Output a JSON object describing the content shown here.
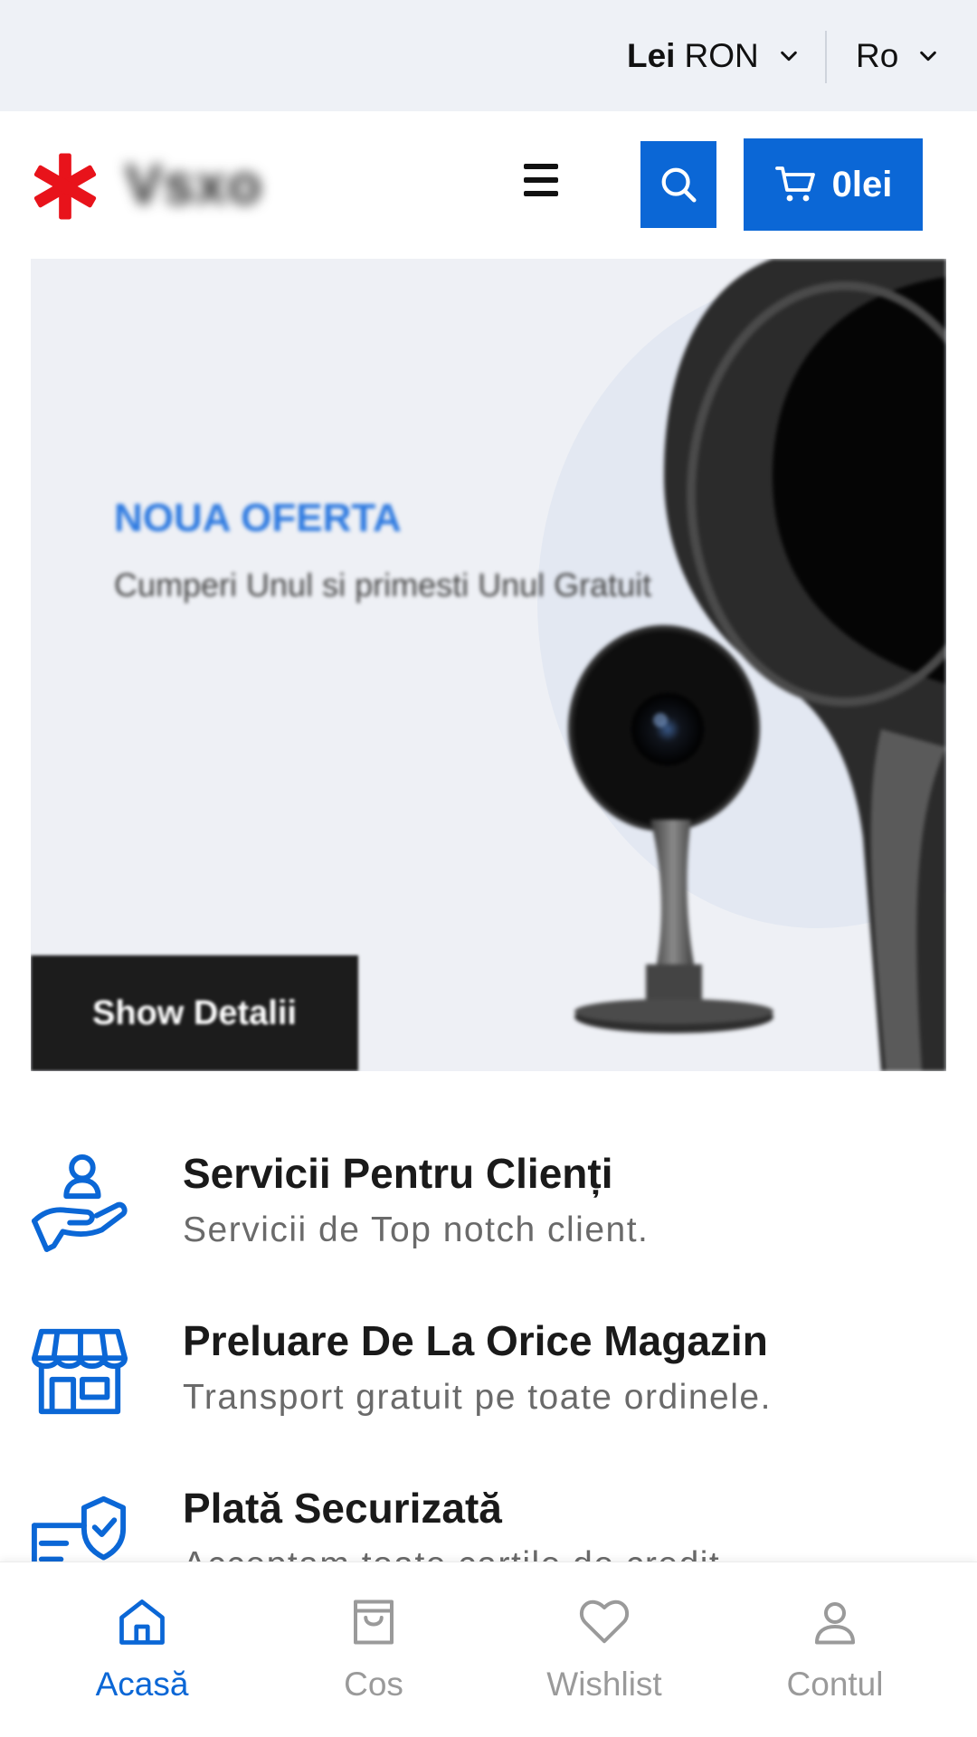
{
  "topbar": {
    "currency_bold": "Lei",
    "currency_code": "RON",
    "language": "Ro"
  },
  "header": {
    "logo_text": "Vsxo",
    "cart_total": "0lei"
  },
  "hero": {
    "title": "NOUA OFERTA",
    "subtitle": "Cumperi Unul si primesti Unul Gratuit",
    "button_label": "Show Detalii"
  },
  "features": [
    {
      "title": "Servicii Pentru Clienți",
      "description": "Servicii de Top notch client.",
      "icon": "customer-service-icon"
    },
    {
      "title": "Preluare De La Orice Magazin",
      "description": "Transport gratuit pe toate ordinele.",
      "icon": "store-icon"
    },
    {
      "title": "Plată Securizată",
      "description": "Acceptam toate cartile de credit",
      "icon": "secure-payment-icon"
    }
  ],
  "bottom_nav": [
    {
      "label": "Acasă",
      "icon": "home-icon",
      "active": true
    },
    {
      "label": "Cos",
      "icon": "bag-icon",
      "active": false
    },
    {
      "label": "Wishlist",
      "icon": "heart-icon",
      "active": false
    },
    {
      "label": "Contul",
      "icon": "user-icon",
      "active": false
    }
  ],
  "colors": {
    "accent": "#0b67d6",
    "topbar_bg": "#eef1f6",
    "logo_red": "#e8131b",
    "hero_title": "#2e7ae0"
  }
}
